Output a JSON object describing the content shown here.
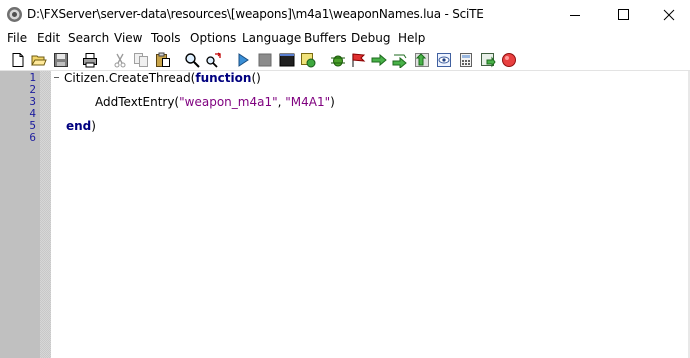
{
  "window": {
    "title": "D:\\FXServer\\server-data\\resources\\[weapons]\\m4a1\\weaponNames.lua - SciTE"
  },
  "menu": {
    "items": [
      "File",
      "Edit",
      "Search",
      "View",
      "Tools",
      "Options",
      "Language",
      "Buffers",
      "Debug",
      "Help"
    ]
  },
  "toolbar": {
    "icons": [
      "new-file-icon",
      "open-folder-icon",
      "save-icon",
      "print-icon",
      "cut-icon",
      "copy-icon",
      "paste-icon",
      "find-icon",
      "replace-icon",
      "compile-icon",
      "stop-icon",
      "output-icon",
      "macro-icon",
      "bug-icon",
      "flag-icon",
      "step-into-icon",
      "step-over-icon",
      "step-out-icon",
      "watch-icon",
      "calculator-icon",
      "breakpoint-icon",
      "stop-execution-icon"
    ]
  },
  "editor": {
    "line_numbers": [
      "1",
      "2",
      "3",
      "4",
      "5",
      "6"
    ],
    "code": {
      "line1_a": "Citizen.CreateThread(",
      "line1_kw": "function",
      "line1_b": "()",
      "line3_a": "AddTextEntry(",
      "line3_s1": "\"weapon_m4a1\"",
      "line3_c": ", ",
      "line3_s2": "\"M4A1\"",
      "line3_d": ")",
      "line5_kw": "end",
      "line5_b": ")"
    }
  },
  "colors": {
    "keyword": "#00007f",
    "string": "#7f007f",
    "line_number": "#1c1c9e",
    "gutter": "#c0c0c0"
  }
}
